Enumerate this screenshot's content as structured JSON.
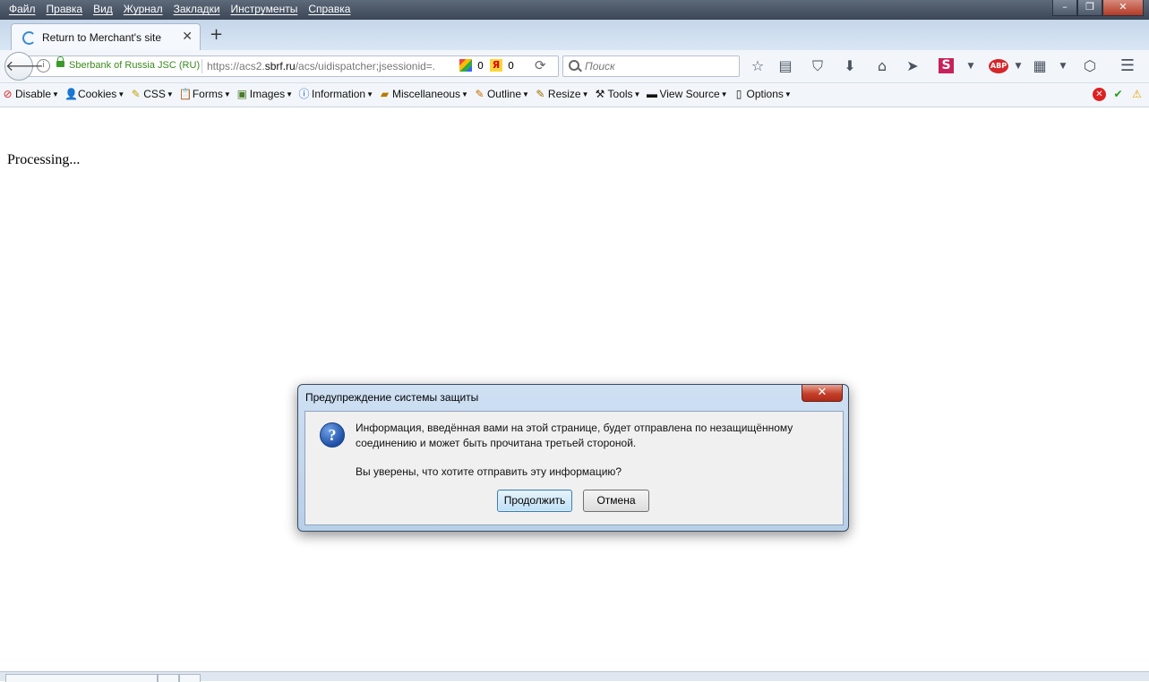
{
  "menubar": {
    "items": [
      "Файл",
      "Правка",
      "Вид",
      "Журнал",
      "Закладки",
      "Инструменты",
      "Справка"
    ]
  },
  "tab": {
    "title": "Return to Merchant's site"
  },
  "urlbar": {
    "site_identity": "Sberbank of Russia JSC (RU)",
    "url_prefix": "https://acs2.",
    "url_domain": "sbrf.ru",
    "url_rest": "/acs/uidispatcher;jsessionid=.",
    "google_count": "0",
    "yandex_label": "Я",
    "yandex_count": "0"
  },
  "search": {
    "placeholder": "Поиск"
  },
  "devbar": {
    "items": [
      "Disable",
      "Cookies",
      "CSS",
      "Forms",
      "Images",
      "Information",
      "Miscellaneous",
      "Outline",
      "Resize",
      "Tools",
      "View Source",
      "Options"
    ]
  },
  "content": {
    "text": "Processing..."
  },
  "dialog": {
    "title": "Предупреждение системы защиты",
    "message_line1": "Информация, введённая вами на этой странице, будет отправлена по незащищённому",
    "message_line2": "соединению и может быть прочитана третьей стороной.",
    "question": "Вы уверены, что хотите отправить эту информацию?",
    "continue_label": "Продолжить",
    "cancel_label": "Отмена"
  }
}
